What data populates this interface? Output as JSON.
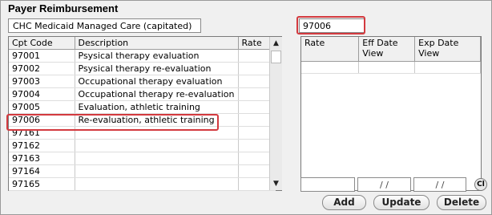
{
  "section_title": "Payer Reimbursement",
  "plan_name": "CHC Medicaid Managed Care (capitated)",
  "cpt_search_value": "97006",
  "left_grid": {
    "headers": [
      "Cpt Code",
      "Description",
      "Rate"
    ],
    "rows": [
      {
        "code": "97001",
        "description": "Psysical therapy evaluation",
        "rate": ""
      },
      {
        "code": "97002",
        "description": "Psysical therapy re-evaluation",
        "rate": ""
      },
      {
        "code": "97003",
        "description": "Occupational therapy evaluation",
        "rate": ""
      },
      {
        "code": "97004",
        "description": "Occupational therapy re-evaluation",
        "rate": ""
      },
      {
        "code": "97005",
        "description": "Evaluation, athletic training",
        "rate": ""
      },
      {
        "code": "97006",
        "description": "Re-evaluation, athletic training",
        "rate": ""
      },
      {
        "code": "97161",
        "description": "",
        "rate": ""
      },
      {
        "code": "97162",
        "description": "",
        "rate": ""
      },
      {
        "code": "97163",
        "description": "",
        "rate": ""
      },
      {
        "code": "97164",
        "description": "",
        "rate": ""
      },
      {
        "code": "97165",
        "description": "",
        "rate": ""
      }
    ],
    "scroll_up_icon": "triangle-up-icon",
    "scroll_down_icon": "triangle-down-icon"
  },
  "right_grid": {
    "headers": [
      {
        "line1": "Rate",
        "line2": ""
      },
      {
        "line1": "Eff Date",
        "line2": "View"
      },
      {
        "line1": "Exp Date",
        "line2": "View"
      }
    ]
  },
  "edit_row": {
    "rate": "",
    "eff_date": "/ /",
    "exp_date": "/ /",
    "clear_label": "Cl"
  },
  "buttons": {
    "add": "Add",
    "update": "Update",
    "delete": "Delete"
  },
  "highlight_color": "#d33a3f"
}
